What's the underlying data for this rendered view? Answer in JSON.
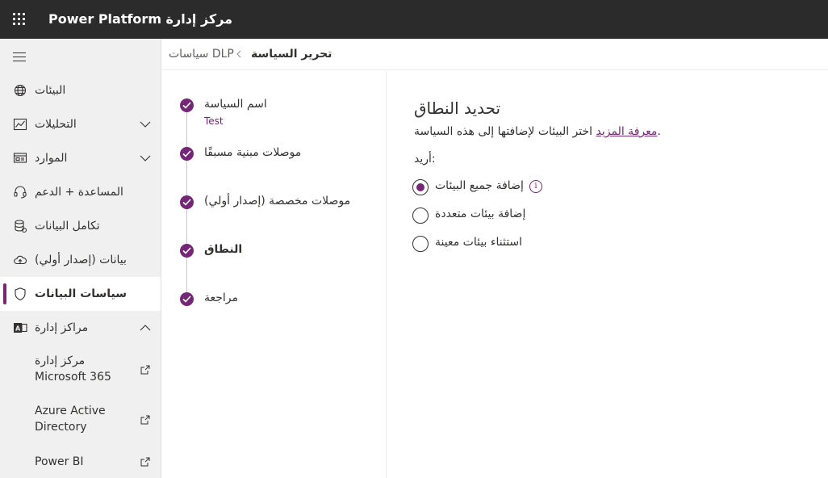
{
  "header": {
    "app_title": "مركز إدارة Power Platform"
  },
  "sidebar": {
    "items": [
      {
        "label": "البيئات",
        "icon": "globe-icon",
        "chevron": ""
      },
      {
        "label": "التحليلات",
        "icon": "chart-icon",
        "chevron": "down"
      },
      {
        "label": "الموارد",
        "icon": "resources-icon",
        "chevron": "down"
      },
      {
        "label": "المساعدة + الدعم",
        "icon": "headset-icon",
        "chevron": ""
      },
      {
        "label": "تكامل البيانات",
        "icon": "database-icon",
        "chevron": ""
      },
      {
        "label": "بيانات (إصدار أولي)",
        "icon": "cloud-icon",
        "chevron": ""
      },
      {
        "label": "سياسات البيانات",
        "icon": "shield-icon",
        "chevron": "",
        "active": true
      },
      {
        "label": "مراكز إدارة",
        "icon": "admin-centers-icon",
        "chevron": "up"
      }
    ],
    "sub_items": [
      {
        "label": "مركز إدارة Microsoft 365",
        "icon": "external-link-icon"
      },
      {
        "label": "Azure Active Directory",
        "icon": "external-link-icon"
      },
      {
        "label": "Power BI",
        "icon": "external-link-icon"
      }
    ]
  },
  "breadcrumb": {
    "root": "سياسات DLP",
    "current": "تحرير السياسة"
  },
  "steps": [
    {
      "label": "اسم السياسة",
      "sub": "Test"
    },
    {
      "label": "موصلات مبنية مسبقًا",
      "sub": ""
    },
    {
      "label": "موصلات مخصصة (إصدار أولي)",
      "sub": ""
    },
    {
      "label": "النطاق",
      "sub": "",
      "current": true
    },
    {
      "label": "مراجعة",
      "sub": ""
    }
  ],
  "content": {
    "title": "تحديد النطاق",
    "description": "اختر البيئات لإضافتها إلى هذه السياسة.",
    "learn_more": "معرفة المزيد",
    "want_label": "أريد:",
    "options": [
      {
        "label": "إضافة جميع البيئات",
        "checked": true,
        "info": true
      },
      {
        "label": "إضافة بيئات متعددة",
        "checked": false,
        "info": false
      },
      {
        "label": "استثناء بيئات معينة",
        "checked": false,
        "info": false
      }
    ]
  },
  "colors": {
    "accent": "#742774",
    "topbar": "#2b2b2b",
    "sidebar": "#f0f0f0"
  }
}
